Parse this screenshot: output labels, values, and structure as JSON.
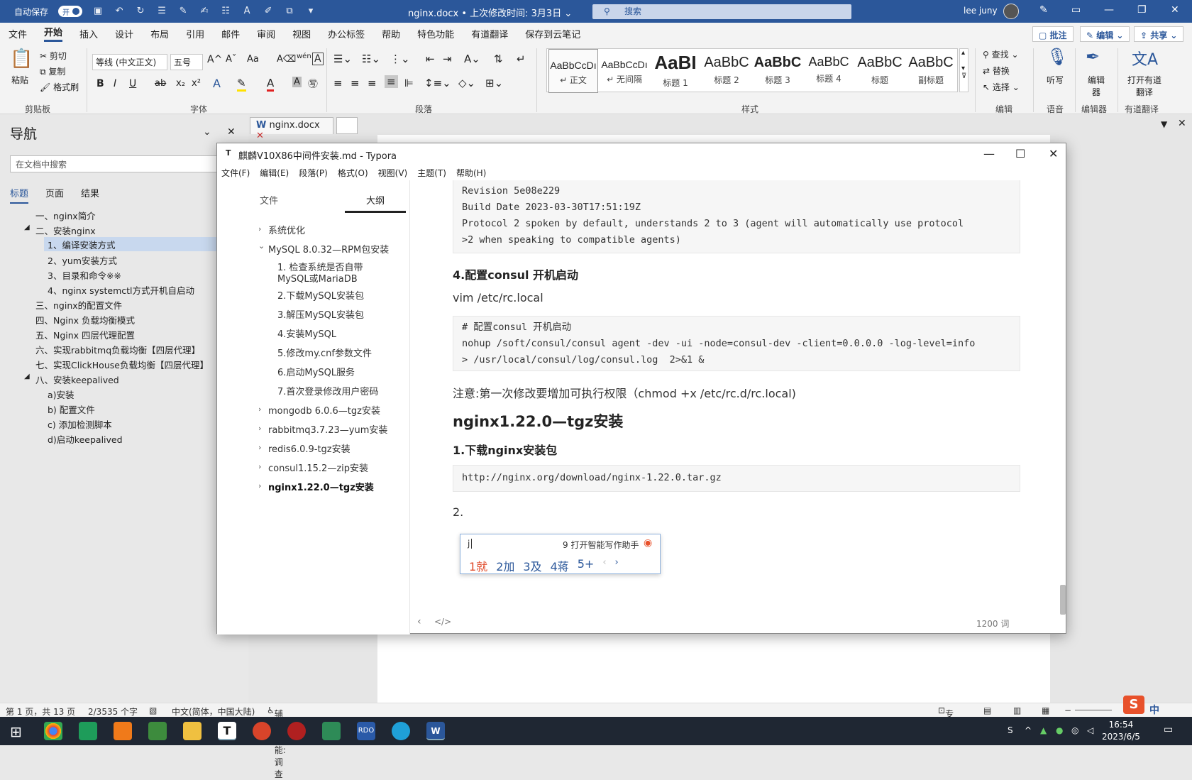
{
  "word": {
    "autosave_label": "自动保存",
    "autosave_state": "开",
    "doc_title": "nginx.docx • 上次修改时间: 3月3日 ⌄",
    "search_placeholder": "搜索",
    "user": "lee juny",
    "tabs": [
      "文件",
      "开始",
      "插入",
      "设计",
      "布局",
      "引用",
      "邮件",
      "审阅",
      "视图",
      "办公标签",
      "帮助",
      "特色功能",
      "有道翻译",
      "保存到云笔记"
    ],
    "right_buttons": {
      "comment": "批注",
      "edit": "编辑",
      "share": "共享"
    },
    "ribbon": {
      "clipboard": {
        "paste": "粘贴",
        "cut": "剪切",
        "copy": "复制",
        "format_painter": "格式刷",
        "label": "剪贴板"
      },
      "font": {
        "family": "等线 (中文正文)",
        "size": "五号",
        "label": "字体"
      },
      "paragraph_label": "段落",
      "styles": [
        {
          "preview": "AaBbCcDı",
          "name": "↵ 正文"
        },
        {
          "preview": "AaBbCcDı",
          "name": "↵ 无间隔"
        },
        {
          "preview": "AaBI",
          "name": "标题 1"
        },
        {
          "preview": "AaBbC",
          "name": "标题 2"
        },
        {
          "preview": "AaBbC",
          "name": "标题 3"
        },
        {
          "preview": "AaBbC",
          "name": "标题 4"
        },
        {
          "preview": "AaBbC",
          "name": "标题"
        },
        {
          "preview": "AaBbC",
          "name": "副标题"
        }
      ],
      "styles_label": "样式",
      "editing": {
        "find": "查找",
        "replace": "替换",
        "select": "选择",
        "label": "编辑"
      },
      "voice": {
        "dictate": "听写",
        "label": "语音"
      },
      "editor": {
        "name": "编辑器",
        "label": "编辑器"
      },
      "translate": {
        "name": "打开有道翻译",
        "label": "有道翻译"
      }
    },
    "nav": {
      "title": "导航",
      "search_placeholder": "在文档中搜索",
      "tabs": [
        "标题",
        "页面",
        "结果"
      ],
      "items": [
        "一、nginx简介",
        "二、安装nginx",
        "1、编译安装方式",
        "2、yum安装方式",
        "3、目录和命令※※",
        "4、nginx systemctl方式开机自启动",
        "三、nginx的配置文件",
        "四、Nginx 负载均衡模式",
        "五、Nginx 四层代理配置",
        "六、实现rabbitmq负载均衡【四层代理】",
        "七、实现ClickHouse负载均衡【四层代理】",
        "八、安装keepalived",
        "a)安装",
        "b) 配置文件",
        "c) 添加检测脚本",
        "d)启动keepalived"
      ]
    },
    "doc_tab": "nginx.docx",
    "status": {
      "page": "第 1 页，共 13 页",
      "words": "2/3535 个字",
      "lang": "中文(简体，中国大陆)",
      "accessibility": "辅助功能: 调查",
      "focus": "专注"
    }
  },
  "typora": {
    "title": "麒麟V10X86中间件安装.md - Typora",
    "menu": [
      "文件(F)",
      "编辑(E)",
      "段落(P)",
      "格式(O)",
      "视图(V)",
      "主题(T)",
      "帮助(H)"
    ],
    "side_tabs": [
      "文件",
      "大纲"
    ],
    "outline": [
      {
        "text": "系统优化",
        "level": 1,
        "chev": "›"
      },
      {
        "text": "MySQL 8.0.32—RPM包安装",
        "level": 1,
        "chev": "⌄"
      },
      {
        "text": "1. 检查系统是否自带",
        "level": 2
      },
      {
        "text": "MySQL或MariaDB",
        "level": 2
      },
      {
        "text": "2.下载MySQL安装包",
        "level": 2
      },
      {
        "text": "3.解压MySQL安装包",
        "level": 2
      },
      {
        "text": "4.安装MySQL",
        "level": 2
      },
      {
        "text": "5.修改my.cnf参数文件",
        "level": 2
      },
      {
        "text": "6.启动MySQL服务",
        "level": 2
      },
      {
        "text": "7.首次登录修改用户密码",
        "level": 2
      },
      {
        "text": "mongodb 6.0.6—tgz安装",
        "level": 1,
        "chev": "›"
      },
      {
        "text": "rabbitmq3.7.23—yum安装",
        "level": 1,
        "chev": "›"
      },
      {
        "text": "redis6.0.9-tgz安装",
        "level": 1,
        "chev": "›"
      },
      {
        "text": "consul1.15.2—zip安装",
        "level": 1,
        "chev": "›"
      },
      {
        "text": "nginx1.22.0—tgz安装",
        "level": 1,
        "chev": "›"
      }
    ],
    "content": {
      "code1": "Revision 5e08e229\nBuild Date 2023-03-30T17:51:19Z\nProtocol 2 spoken by default, understands 2 to 3 (agent will automatically use protocol\n>2 when speaking to compatible agents)",
      "h_consul": "4.配置consul 开机启动",
      "p_vim": "vim /etc/rc.local",
      "code2": "# 配置consul 开机启动\nnohup /soft/consul/consul agent -dev -ui -node=consul-dev -client=0.0.0.0 -log-level=info\n> /usr/local/consul/log/consul.log  2>&1 &",
      "p_note": "注意:第一次修改要增加可执行权限（chmod +x /etc/rc.d/rc.local)",
      "h2_nginx": "nginx1.22.0—tgz安装",
      "h_download": "1.下载nginx安装包",
      "code3": "http://nginx.org/download/nginx-1.22.0.tar.gz",
      "list2": "2."
    },
    "word_count": "1200 词"
  },
  "ime": {
    "input": "j",
    "assistant": "9 打开智能写作助手",
    "candidates": [
      "1就",
      "2加",
      "3及",
      "4蒋",
      "5+"
    ]
  },
  "taskbar": {
    "time": "16:54",
    "date": "2023/6/5",
    "ime_mode": "中"
  }
}
